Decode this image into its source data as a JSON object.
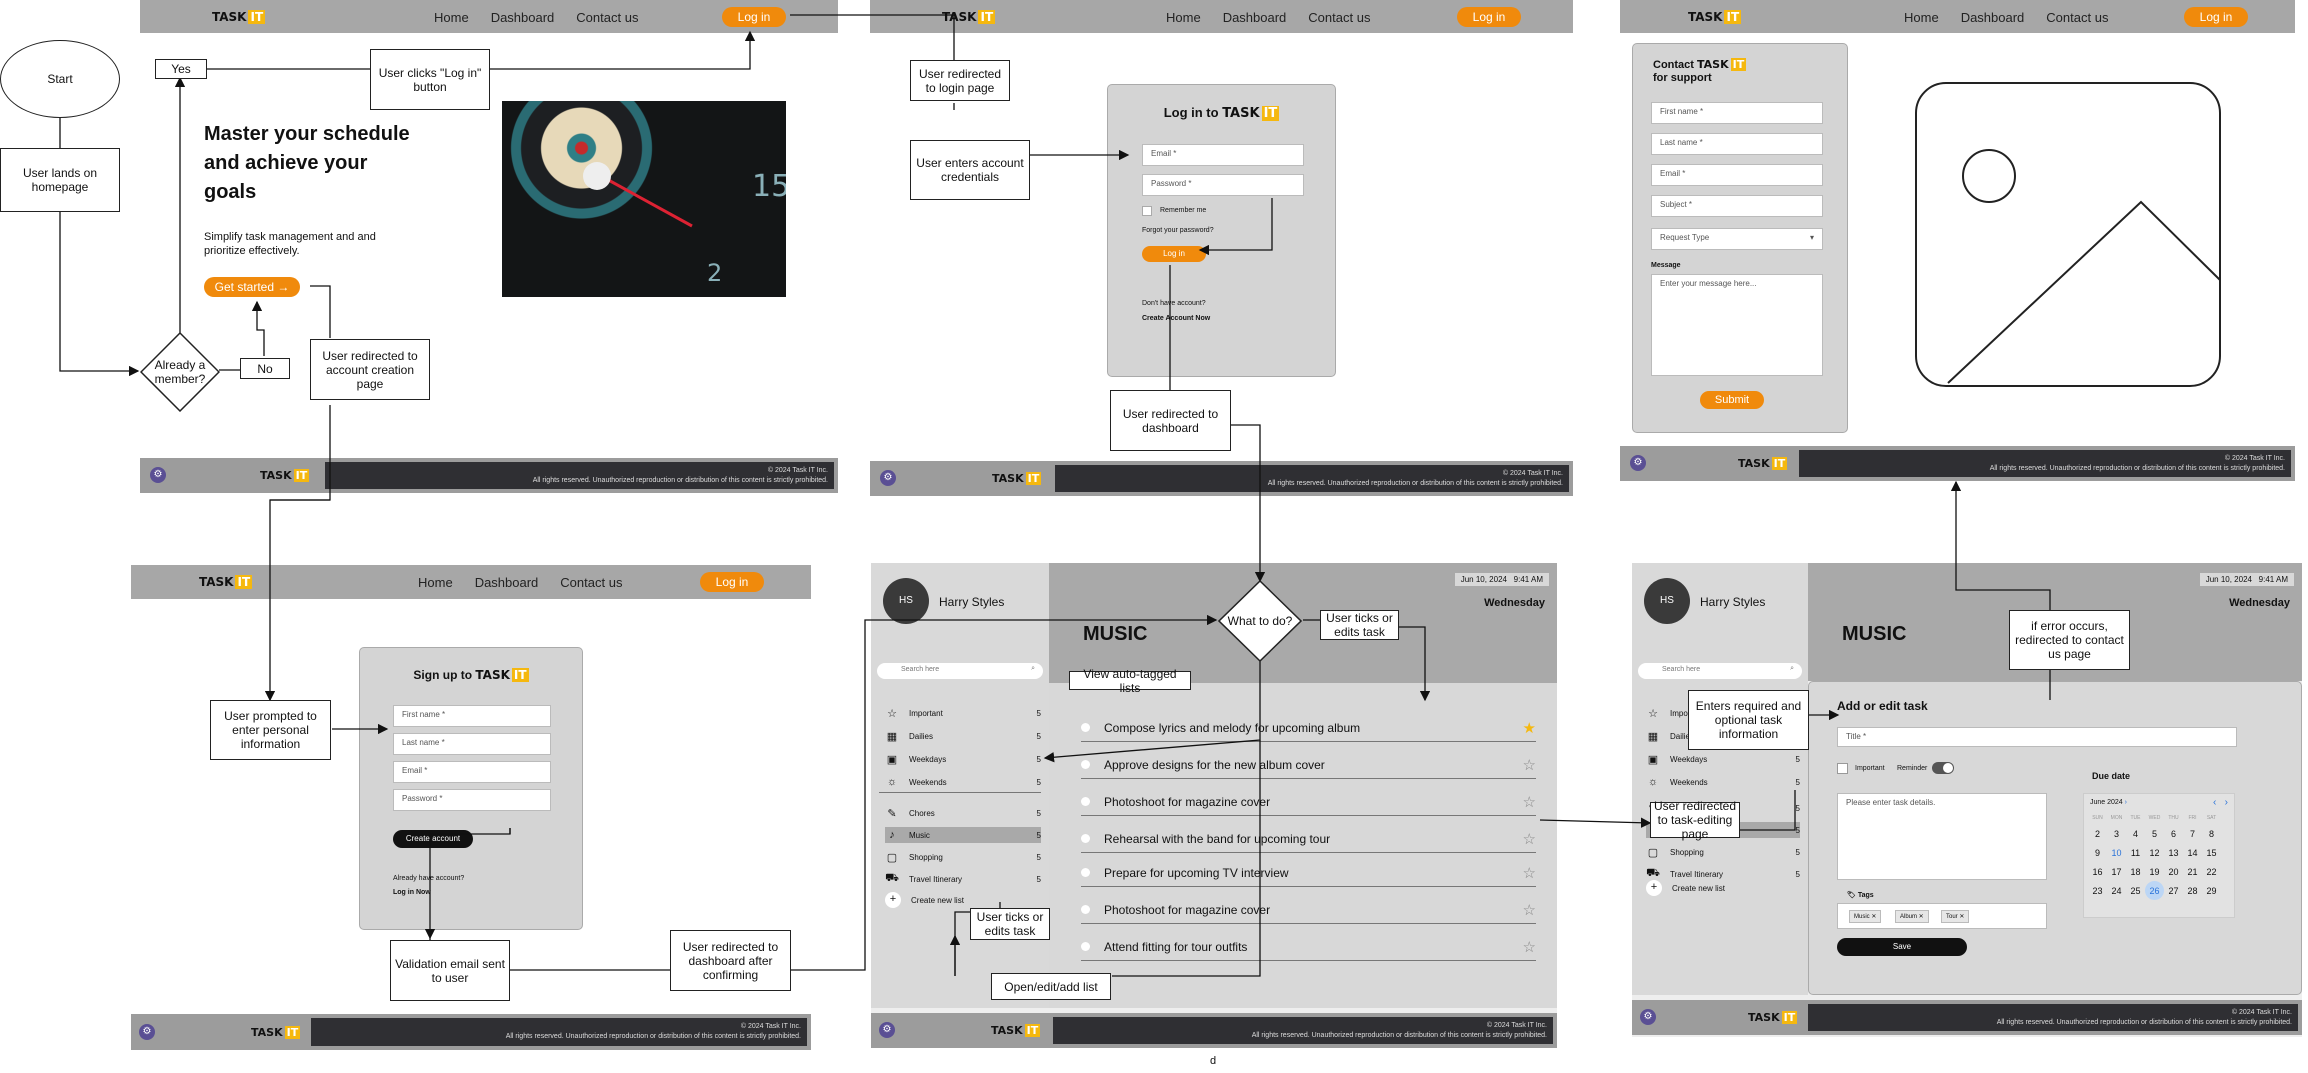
{
  "brand": {
    "logo_word": "TASK",
    "logo_accent": "IT",
    "accent": "#f08a0c",
    "yellow": "#f5b80f"
  },
  "nav": {
    "home": "Home",
    "dashboard": "Dashboard",
    "contact": "Contact us",
    "login": "Log in"
  },
  "footer": {
    "copyright": "© 2024 Task IT Inc.",
    "rights": "All rights reserved. Unauthorized reproduction or distribution of this content is strictly prohibited.",
    "gear_icon": "gear-icon"
  },
  "home": {
    "headline": "Master your schedule and achieve your goals",
    "sub": "Simplify task management and and prioritize effectively.",
    "cta": "Get started",
    "cta_arrow": "→"
  },
  "login": {
    "title": "Log in to",
    "email": "Email *",
    "password": "Password *",
    "remember": "Remember me",
    "forgot": "Forgot your password?",
    "button": "Log in",
    "no_account": "Don't have account?",
    "create": "Create Account Now"
  },
  "contact": {
    "title_pre": "Contact",
    "title_post": "for support",
    "first": "First name *",
    "last": "Last name *",
    "email": "Email *",
    "subject": "Subject *",
    "request": "Request Type",
    "message_label": "Message",
    "message_ph": "Enter your message here...",
    "submit": "Submit"
  },
  "signup": {
    "title": "Sign up to",
    "first": "First name *",
    "last": "Last name *",
    "email": "Email *",
    "password": "Password *",
    "button": "Create account",
    "already": "Already have account?",
    "login_now": "Log in Now"
  },
  "dashboard": {
    "initials": "HS",
    "user": "Harry Styles",
    "search": "Search here",
    "date": "Jun 10, 2024",
    "time": "9:41 AM",
    "weekday": "Wednesday",
    "list_title": "MUSIC",
    "lists": [
      {
        "label": "Important",
        "count": "5",
        "icon": "star-icon"
      },
      {
        "label": "Dailies",
        "count": "5",
        "icon": "calendar-icon"
      },
      {
        "label": "Weekdays",
        "count": "5",
        "icon": "briefcase-icon"
      },
      {
        "label": "Weekends",
        "count": "5",
        "icon": "sun-icon"
      }
    ],
    "categories": [
      {
        "label": "Chores",
        "count": "5",
        "icon": "wrench-icon"
      },
      {
        "label": "Music",
        "count": "5",
        "icon": "music-icon"
      },
      {
        "label": "Shopping",
        "count": "5",
        "icon": "bag-icon"
      },
      {
        "label": "Travel Itinerary",
        "count": "5",
        "icon": "truck-icon"
      }
    ],
    "new_list": "Create new list",
    "tasks": [
      "Compose lyrics and melody for upcoming album",
      "Approve designs for the new album cover",
      "Photoshoot for magazine cover",
      "Rehearsal with the band for upcoming tour",
      "Prepare for upcoming TV interview",
      "Photoshoot for magazine cover",
      "Attend fitting for tour outfits"
    ]
  },
  "edit": {
    "lists": [
      {
        "label": "Important",
        "count": "5"
      },
      {
        "label": "Dailies",
        "count": "5"
      },
      {
        "label": "Weekdays",
        "count": "5"
      },
      {
        "label": "Weekends",
        "count": "5"
      }
    ],
    "categories": [
      {
        "label": "Chores",
        "count": "5"
      },
      {
        "label": "Music",
        "count": "5"
      },
      {
        "label": "Shopping",
        "count": "5"
      },
      {
        "label": "Travel Itinerary",
        "count": "5"
      }
    ],
    "heading": "Add or edit task",
    "title_ph": "Title *",
    "important": "Important",
    "reminder": "Reminder",
    "details_ph": "Please enter task details.",
    "tags_label": "Tags",
    "tags": [
      "Music",
      "Album",
      "Tour"
    ],
    "save": "Save",
    "due": "Due date",
    "month": "June 2024",
    "dow": [
      "SUN",
      "MON",
      "TUE",
      "WED",
      "THU",
      "FRI",
      "SAT"
    ],
    "weeks": [
      [
        "2",
        "3",
        "4",
        "5",
        "6",
        "7",
        "8"
      ],
      [
        "9",
        "10",
        "11",
        "12",
        "13",
        "14",
        "15"
      ],
      [
        "16",
        "17",
        "18",
        "19",
        "20",
        "21",
        "22"
      ],
      [
        "23",
        "24",
        "25",
        "26",
        "27",
        "28",
        "29"
      ]
    ]
  },
  "flow": {
    "start": "Start",
    "lands": "User lands on homepage",
    "member": "Already a member?",
    "yes": "Yes",
    "no": "No",
    "clicks_login": "User clicks \"Log in\" button",
    "to_signup": "User redirected to account creation page",
    "to_login": "User redirected to login page",
    "enters_creds": "User enters account credentials",
    "to_dashboard": "User redirected to dashboard",
    "what_to_do": "What to do?",
    "ticks_edits": "User ticks or edits task",
    "view_auto": "View auto-tagged lists",
    "ticks_edits2": "User ticks or edits task",
    "open_list": "Open/edit/add list",
    "prompted": "User prompted to enter personal information",
    "validation": "Validation email sent to user",
    "after_confirm": "User redirected to dashboard after confirming",
    "to_edit": "User redirected to task-editing page",
    "enters_task": "Enters required and optional task information",
    "error": "if error occurs, redirected to contact us page",
    "caption": "d"
  }
}
